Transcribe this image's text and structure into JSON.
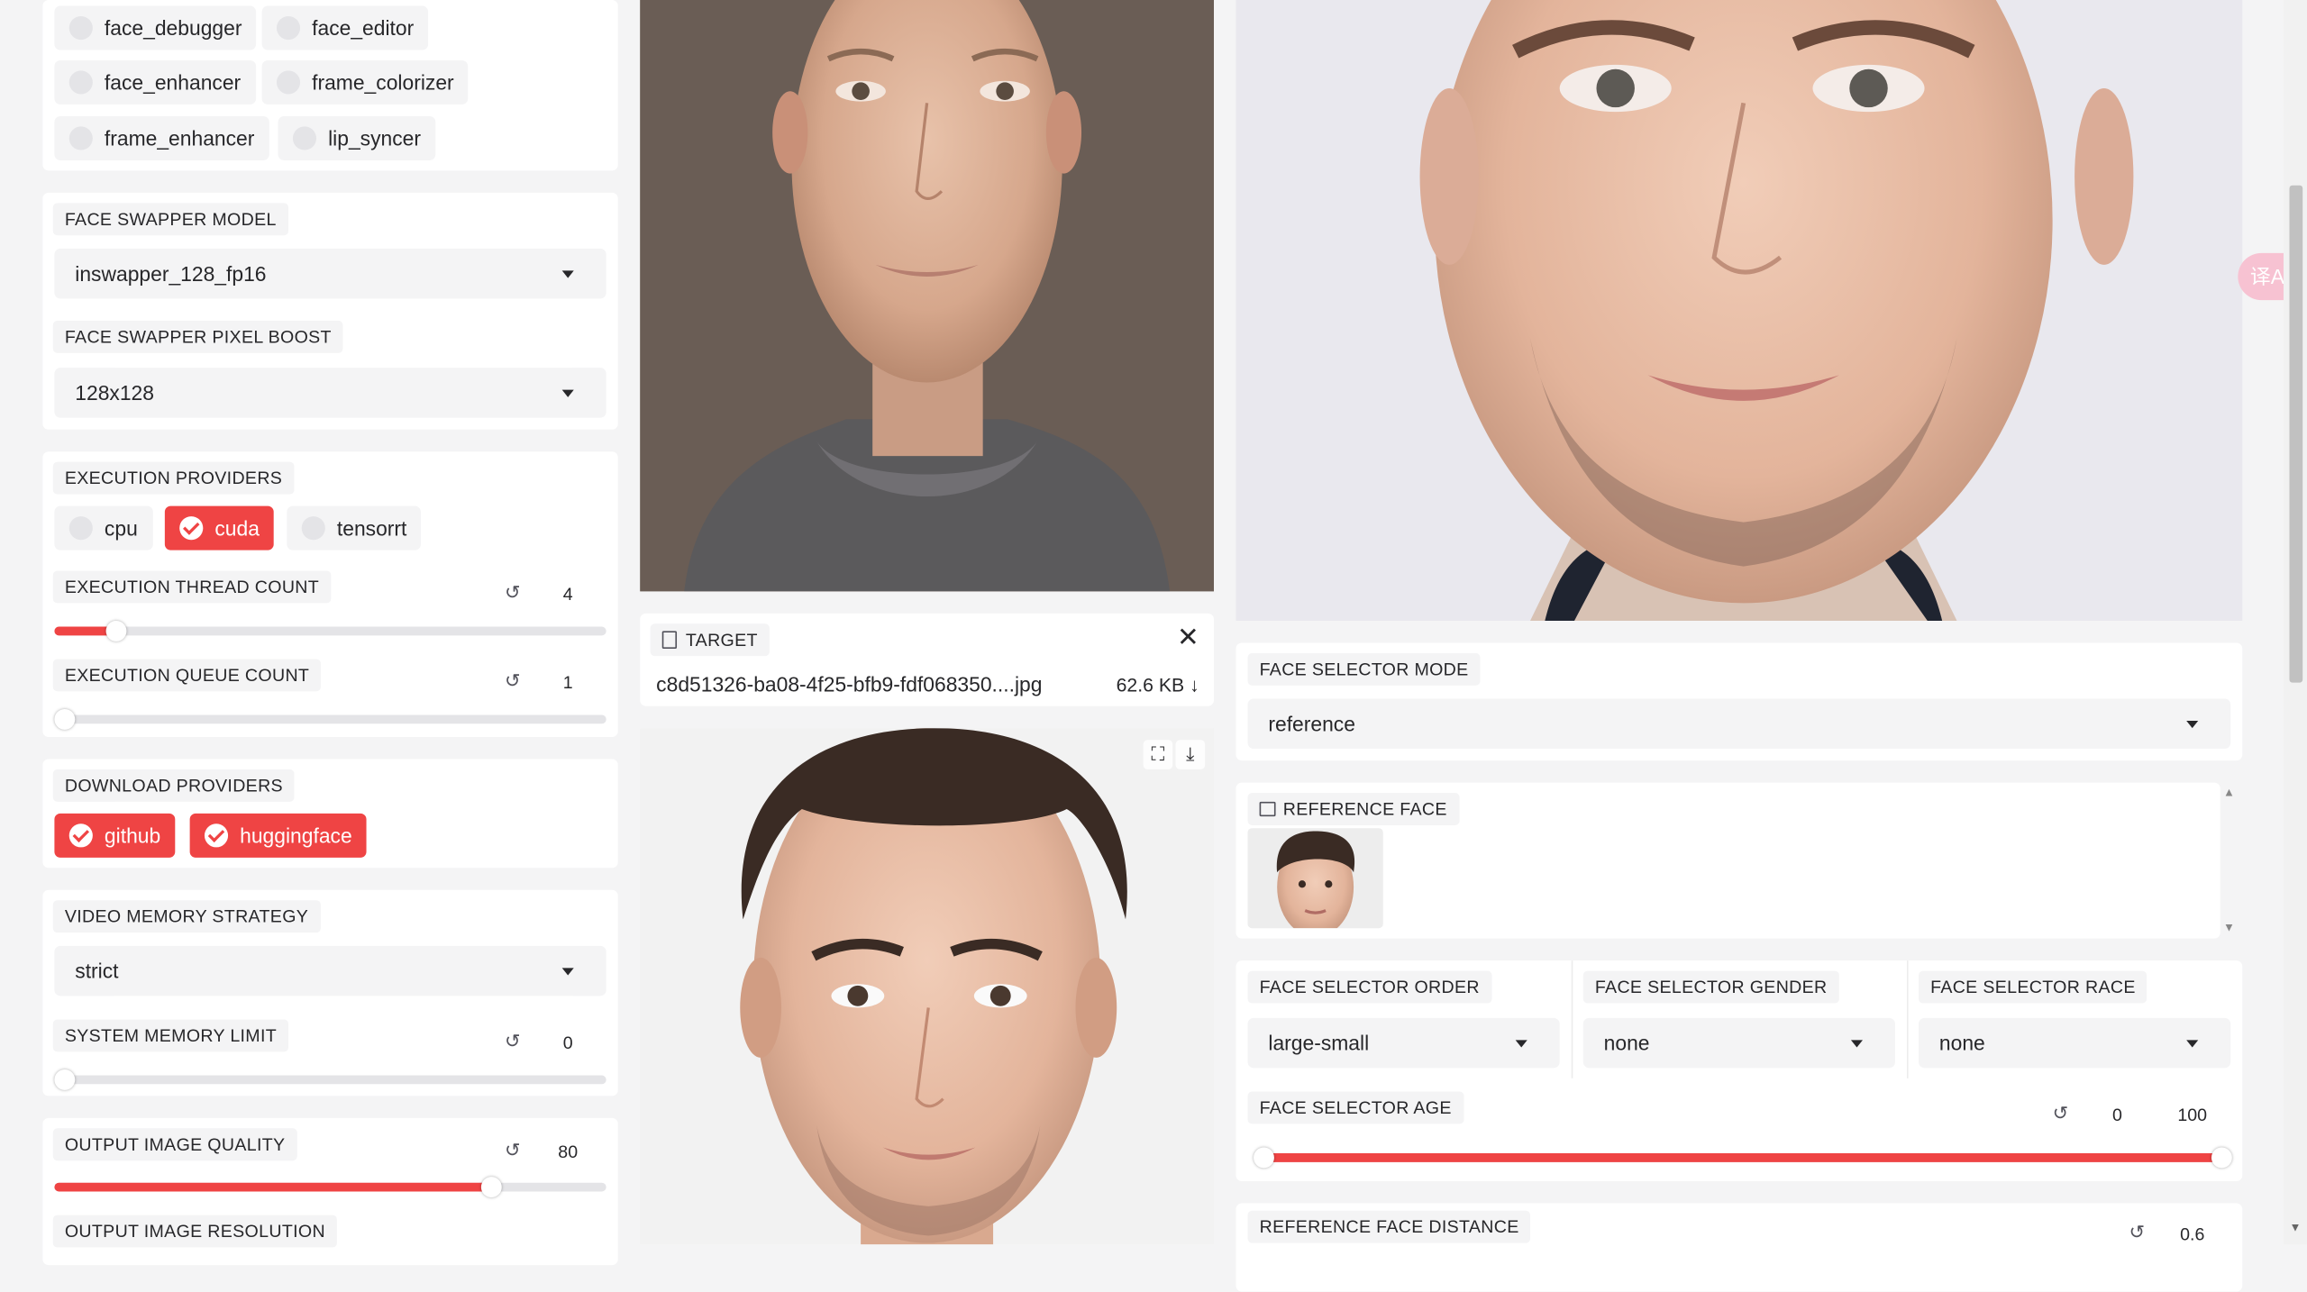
{
  "processors": [
    "face_debugger",
    "face_editor",
    "face_enhancer",
    "frame_colorizer",
    "frame_enhancer",
    "lip_syncer"
  ],
  "face_swapper_model": {
    "label": "FACE SWAPPER MODEL",
    "value": "inswapper_128_fp16"
  },
  "face_swapper_pixel_boost": {
    "label": "FACE SWAPPER PIXEL BOOST",
    "value": "128x128"
  },
  "execution_providers": {
    "label": "EXECUTION PROVIDERS",
    "options": [
      "cpu",
      "cuda",
      "tensorrt"
    ],
    "selected": [
      "cuda"
    ]
  },
  "execution_thread_count": {
    "label": "EXECUTION THREAD COUNT",
    "value": "4",
    "level": 0.11
  },
  "execution_queue_count": {
    "label": "EXECUTION QUEUE COUNT",
    "value": "1",
    "level": 0.0
  },
  "download_providers": {
    "label": "DOWNLOAD PROVIDERS",
    "options": [
      "github",
      "huggingface"
    ],
    "selected": [
      "github",
      "huggingface"
    ]
  },
  "video_memory_strategy": {
    "label": "VIDEO MEMORY STRATEGY",
    "value": "strict"
  },
  "system_memory_limit": {
    "label": "SYSTEM MEMORY LIMIT",
    "value": "0",
    "level": 0.0
  },
  "output_image_quality": {
    "label": "OUTPUT IMAGE QUALITY",
    "value": "80",
    "level": 0.8
  },
  "output_image_resolution": {
    "label": "OUTPUT IMAGE RESOLUTION"
  },
  "target": {
    "label": "TARGET",
    "filename": "c8d51326-ba08-4f25-bfb9-fdf068350....jpg",
    "size": "62.6 KB ↓"
  },
  "face_selector_mode": {
    "label": "FACE SELECTOR MODE",
    "value": "reference"
  },
  "reference_face": {
    "label": "REFERENCE FACE"
  },
  "face_selector_order": {
    "label": "FACE SELECTOR ORDER",
    "value": "large-small"
  },
  "face_selector_gender": {
    "label": "FACE SELECTOR GENDER",
    "value": "none"
  },
  "face_selector_race": {
    "label": "FACE SELECTOR RACE",
    "value": "none"
  },
  "face_selector_age": {
    "label": "FACE SELECTOR AGE",
    "min": "0",
    "max": "100",
    "range": [
      0,
      100
    ]
  },
  "reference_face_distance": {
    "label": "REFERENCE FACE DISTANCE",
    "value": "0.6"
  },
  "translate_badge": "译A",
  "colors": {
    "accent": "#ef4444",
    "panel": "#ffffff",
    "background": "#f4f4f5"
  }
}
